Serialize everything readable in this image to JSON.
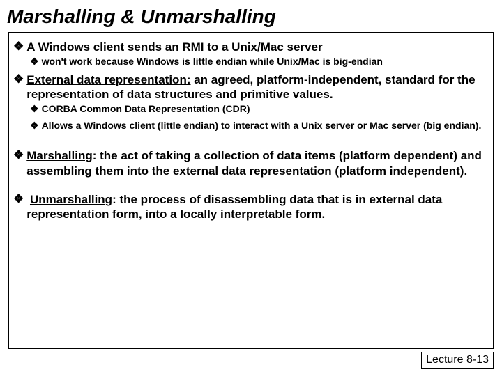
{
  "title": "Marshalling & Unmarshalling",
  "b1": {
    "text": "A Windows client sends an RMI to a Unix/Mac server",
    "sub1": "won't work because Windows is little endian while Unix/Mac is big-endian"
  },
  "b2": {
    "term": "External data representation:",
    "rest": " an agreed, platform-independent, standard for the representation of data structures and primitive values.",
    "sub1": "CORBA Common Data Representation (CDR)",
    "sub2": "Allows a Windows client (little endian) to interact with a Unix server or Mac server (big endian)."
  },
  "b3": {
    "term": "Marshalling",
    "rest": ": the act of taking a collection of data items (platform dependent) and assembling them into the external data representation (platform independent)."
  },
  "b4": {
    "term": "Unmarshalling",
    "rest": ": the process of disassembling data that is in external data representation form, into a locally interpretable form."
  },
  "footer": "Lecture 8-13"
}
